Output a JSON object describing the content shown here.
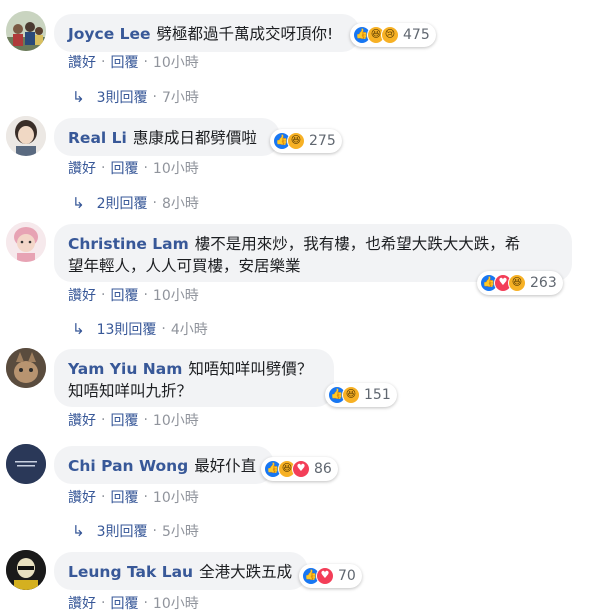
{
  "labels": {
    "like": "讚好",
    "reply": "回覆",
    "dot": "·"
  },
  "colors": {
    "author": "#385898",
    "meta": "#90949c",
    "bubble": "#f2f3f5",
    "like": "#1877f2",
    "love": "#f33e58",
    "haha": "#f7b125"
  },
  "comments": [
    {
      "author": "Joyce Lee",
      "text": "劈極都過千萬成交呀頂你!",
      "reactions": [
        "like-icon",
        "haha-icon",
        "sad-icon"
      ],
      "reaction_count": "475",
      "time": "10小時",
      "replies": {
        "label": "3則回覆",
        "time": "7小時"
      }
    },
    {
      "author": "Real Li",
      "text": "惠康成日都劈價啦",
      "reactions": [
        "like-icon",
        "haha-icon"
      ],
      "reaction_count": "275",
      "time": "10小時",
      "replies": {
        "label": "2則回覆",
        "time": "8小時"
      }
    },
    {
      "author": "Christine Lam",
      "text_line1": "樓不是用來炒，我有樓，也希望大跌大大跌，希",
      "text_line2": "望年輕人，人人可買樓，安居樂業",
      "reactions": [
        "like-icon",
        "love-icon",
        "haha-icon"
      ],
      "reaction_count": "263",
      "time": "10小時",
      "replies": {
        "label": "13則回覆",
        "time": "4小時"
      }
    },
    {
      "author": "Yam Yiu Nam",
      "text_line1": "知唔知咩叫劈價？",
      "text_line2": "知唔知咩叫九折？",
      "reactions": [
        "like-icon",
        "haha-icon"
      ],
      "reaction_count": "151",
      "time": "10小時"
    },
    {
      "author": "Chi Pan Wong",
      "text": "最好仆直",
      "reactions": [
        "like-icon",
        "haha-icon",
        "love-icon"
      ],
      "reaction_count": "86",
      "time": "10小時",
      "replies": {
        "label": "3則回覆",
        "time": "5小時"
      }
    },
    {
      "author": "Leung Tak Lau",
      "text": "全港大跌五成",
      "reactions": [
        "like-icon",
        "love-icon"
      ],
      "reaction_count": "70",
      "time": "10小時"
    }
  ]
}
